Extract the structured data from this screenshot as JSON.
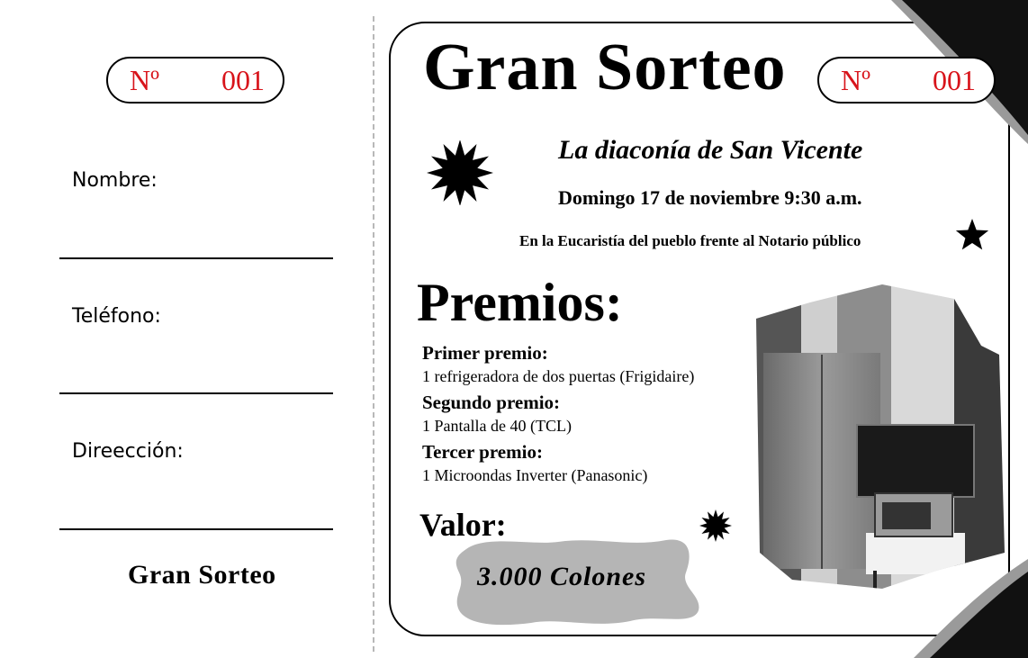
{
  "stub": {
    "number_prefix": "Nº",
    "number_value": "001",
    "fields": [
      {
        "label": "Nombre:"
      },
      {
        "label": "Teléfono:"
      },
      {
        "label": "Direección:"
      }
    ],
    "footer_title": "Gran Sorteo"
  },
  "ticket": {
    "title": "Gran Sorteo",
    "number_prefix": "Nº",
    "number_value": "001",
    "subtitle": "La diaconía de San Vicente",
    "date": "Domingo 17 de noviembre 9:30 a.m.",
    "venue": "En la Eucaristía del pueblo frente al Notario público",
    "prizes_title": "Premios:",
    "prizes": [
      {
        "heading": "Primer premio:",
        "description": "1 refrigeradora de dos puertas (Frigidaire)"
      },
      {
        "heading": "Segundo premio:",
        "description": "1 Pantalla de 40 (TCL)"
      },
      {
        "heading": "Tercer premio:",
        "description": "1 Microondas Inverter (Panasonic)"
      }
    ],
    "price_label": "Valor:",
    "price_value": "3.000 Colones"
  },
  "icons": {
    "large_star": "star-burst-icon",
    "small_star": "star-icon",
    "medium_star": "star-burst-icon"
  },
  "colors": {
    "number_red": "#d8141b",
    "price_blob": "#b5b5b5",
    "corner_dark": "#111111",
    "corner_gray": "#9a9a9a"
  }
}
